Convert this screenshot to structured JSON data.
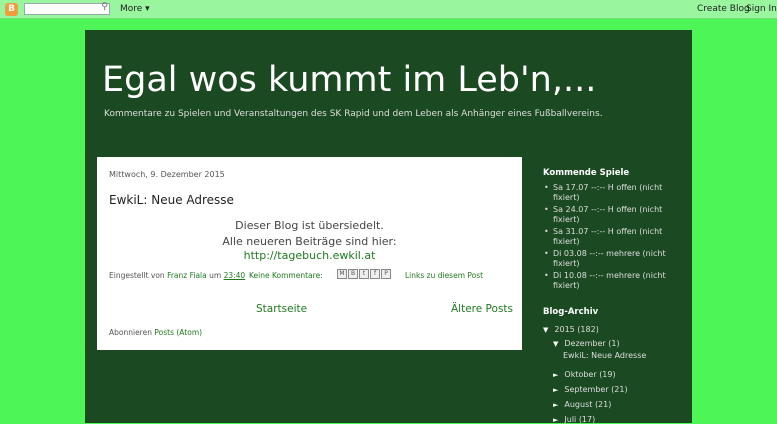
{
  "navbar": {
    "logo_glyph": "B",
    "more_label": "More ▾",
    "create_blog_label": "Create Blog",
    "sign_in_label": "Sign In"
  },
  "blog": {
    "title": "Egal wos kummt im Leb'n,...",
    "description": "Kommentare zu Spielen und Veranstaltungen des SK Rapid und dem Leben als Anhänger eines Fußballvereins."
  },
  "post": {
    "date": "Mittwoch, 9. Dezember 2015",
    "title": "EwkiL: Neue Adresse",
    "body_line1": "Dieser Blog ist übersiedelt.",
    "body_line2": "Alle neueren Beiträge sind hier:",
    "link": "http://tagebuch.ewkil.at",
    "footer_posted_by": "Eingestellt von",
    "author": "Franz Fiala",
    "footer_at": "um",
    "time": "23:40",
    "comments": "Keine Kommentare:",
    "links_to_post": "Links zu diesem Post"
  },
  "pager": {
    "home": "Startseite",
    "older": "Ältere Posts"
  },
  "subscribe": {
    "prefix": "Abonnieren",
    "link": "Posts (Atom)"
  },
  "sidebar": {
    "kommende_title": "Kommende Spiele",
    "kommende_items": [
      "Sa 17.07 --:-- H offen (nicht fixiert)",
      "Sa 24.07 --:-- H offen (nicht fixiert)",
      "Sa 31.07 --:-- H offen (nicht fixiert)",
      "Di 03.08 --:-- mehrere (nicht fixiert)",
      "Di 10.08 --:-- mehrere (nicht fixiert)"
    ],
    "archiv_title": "Blog-Archiv",
    "archive": {
      "year": "2015",
      "year_count": "(182)",
      "months": [
        {
          "name": "Dezember",
          "count": "(1)"
        },
        {
          "name": "Oktober",
          "count": "(19)"
        },
        {
          "name": "September",
          "count": "(21)"
        },
        {
          "name": "August",
          "count": "(21)"
        },
        {
          "name": "Juli",
          "count": "(17)"
        }
      ],
      "post": "EwkiL: Neue Adresse"
    }
  }
}
